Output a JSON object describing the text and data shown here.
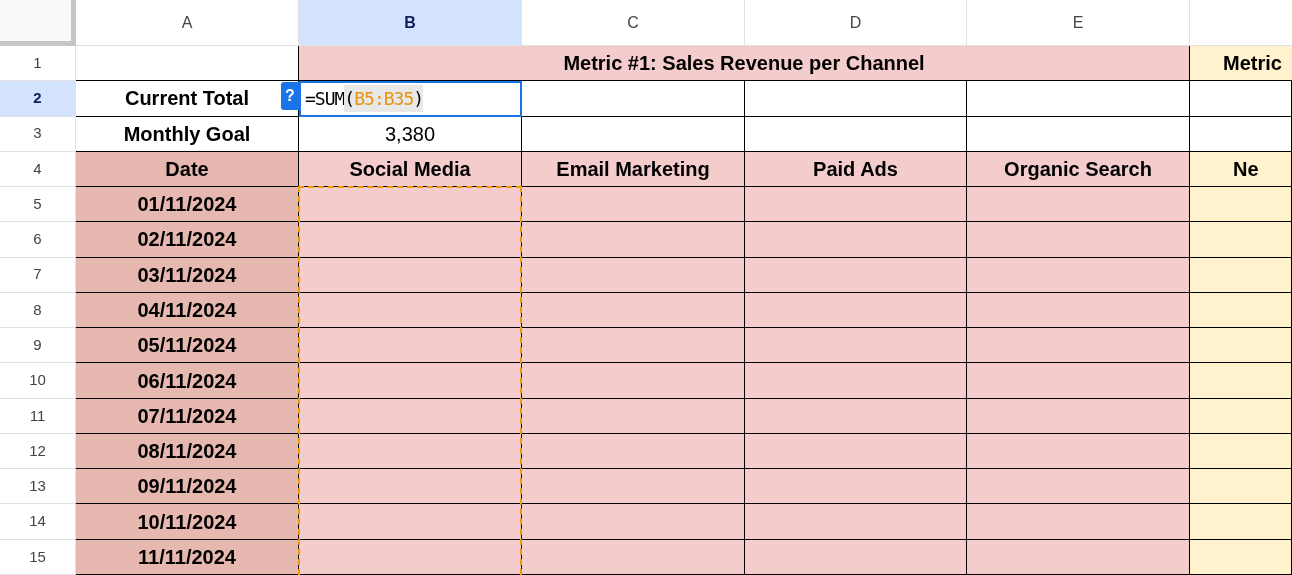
{
  "column_headers": [
    {
      "label": "A",
      "selected": false
    },
    {
      "label": "B",
      "selected": true
    },
    {
      "label": "C",
      "selected": false
    },
    {
      "label": "D",
      "selected": false
    },
    {
      "label": "E",
      "selected": false
    }
  ],
  "row_headers": [
    {
      "label": "1",
      "selected": false
    },
    {
      "label": "2",
      "selected": true
    },
    {
      "label": "3",
      "selected": false
    },
    {
      "label": "4",
      "selected": false
    },
    {
      "label": "5",
      "selected": false
    },
    {
      "label": "6",
      "selected": false
    },
    {
      "label": "7",
      "selected": false
    },
    {
      "label": "8",
      "selected": false
    },
    {
      "label": "9",
      "selected": false
    },
    {
      "label": "10",
      "selected": false
    },
    {
      "label": "11",
      "selected": false
    },
    {
      "label": "12",
      "selected": false
    },
    {
      "label": "13",
      "selected": false
    },
    {
      "label": "14",
      "selected": false
    },
    {
      "label": "15",
      "selected": false
    }
  ],
  "metric_titles": [
    {
      "text": "Metric #1: Sales Revenue per Channel",
      "color": "#f4cccc"
    },
    {
      "text": "Metric",
      "color": "#fff2cc"
    }
  ],
  "current_total": {
    "label": "Current Total",
    "editing": true,
    "help_badge": "?",
    "formula_parts": [
      {
        "text": "=SUM",
        "kind": "function"
      },
      {
        "text": "(",
        "kind": "paren"
      },
      {
        "text": "B5:B35",
        "kind": "reference"
      },
      {
        "text": ")",
        "kind": "paren"
      }
    ]
  },
  "monthly_goal": {
    "label": "Monthly Goal",
    "value": "3,380"
  },
  "channel_headers": [
    {
      "text": "Date",
      "color": "#e6b8af"
    },
    {
      "text": "Social Media",
      "color": "#f4cccc"
    },
    {
      "text": "Email Marketing",
      "color": "#f4cccc"
    },
    {
      "text": "Paid Ads",
      "color": "#f4cccc"
    },
    {
      "text": "Organic Search",
      "color": "#f4cccc"
    },
    {
      "text": "Ne",
      "color": "#fff2cc"
    }
  ],
  "dates": [
    "01/11/2024",
    "02/11/2024",
    "03/11/2024",
    "04/11/2024",
    "05/11/2024",
    "06/11/2024",
    "07/11/2024",
    "08/11/2024",
    "09/11/2024",
    "10/11/2024",
    "11/11/2024"
  ],
  "copy_outline": true
}
